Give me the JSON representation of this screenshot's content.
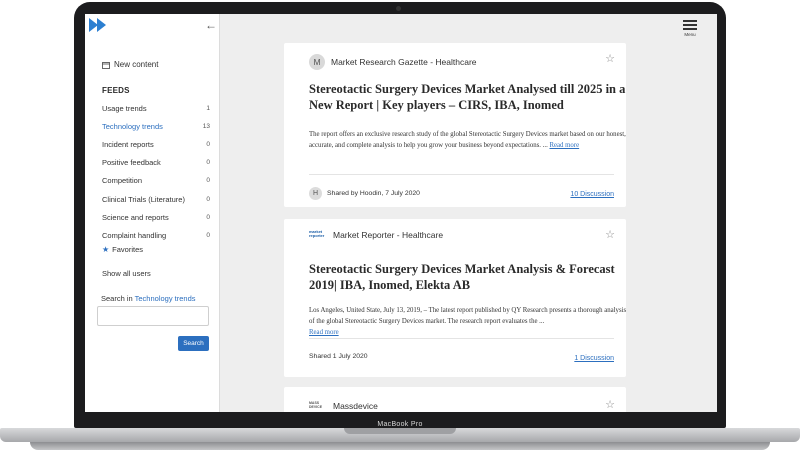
{
  "device": {
    "model_label": "MacBook Pro"
  },
  "sidebar": {
    "new_content_label": "New content",
    "feeds_title": "FEEDS",
    "feeds": [
      {
        "label": "Usage trends",
        "count": "1",
        "active": false
      },
      {
        "label": "Technology trends",
        "count": "13",
        "active": true
      },
      {
        "label": "Incident reports",
        "count": "0",
        "active": false
      },
      {
        "label": "Positive feedback",
        "count": "0",
        "active": false
      },
      {
        "label": "Competition",
        "count": "0",
        "active": false
      },
      {
        "label": "Clinical Trials (Literature)",
        "count": "0",
        "active": false
      },
      {
        "label": "Science and reports",
        "count": "0",
        "active": false
      },
      {
        "label": "Complaint handling",
        "count": "0",
        "active": false
      }
    ],
    "favorites_label": "Favorites",
    "show_all_users_label": "Show all users",
    "search_prefix": "Search in",
    "search_scope": "Technology trends",
    "search_value": "",
    "search_button_label": "Search"
  },
  "topbar": {
    "menu_label": "Menu"
  },
  "cards": [
    {
      "source_avatar": "M",
      "source": "Market Research Gazette - Healthcare",
      "title": "Stereotactic Surgery Devices Market Analysed till 2025 in a New Report | Key players – CIRS, IBA, Inomed",
      "summary": "The report offers an exclusive research study of the global Stereotactic Surgery Devices market based on our honest, accurate, and complete analysis to help you grow your business beyond expectations. ...",
      "read_more": "Read more",
      "sharer_avatar": "H",
      "shared_text": "Shared by Hoodin, 7 July 2020",
      "discussion": "10 Discussion"
    },
    {
      "source_logo_text": "market reporter",
      "source": "Market Reporter - Healthcare",
      "title": "Stereotactic Surgery Devices Market Analysis & Forecast 2019| IBA, Inomed, Elekta AB",
      "summary": "Los Angeles, United State, July 13, 2019, – The latest report published by QY Research presents a thorough analysis of the global Stereotactic Surgery Devices market. The research report evaluates the ...",
      "read_more": "Read more",
      "shared_text": "Shared 1 July 2020",
      "discussion": "1 Discussion"
    },
    {
      "source_logo_text": "MASS DEVICE",
      "source": "Massdevice"
    }
  ],
  "colors": {
    "accent": "#2c6fbf",
    "page_bg": "#eeeeee",
    "card_bg": "#ffffff"
  }
}
